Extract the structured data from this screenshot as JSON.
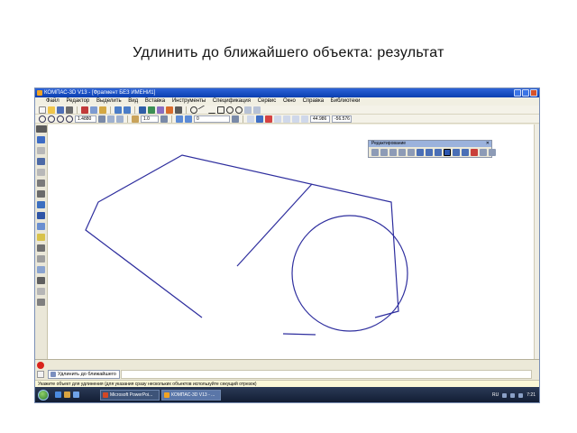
{
  "slide": {
    "title": "Удлинить до  ближайшего объекта: результат"
  },
  "app": {
    "window_title": "КОМПАС-3D V13 - [Фрагмент БЕЗ ИМЕНИ1]",
    "menu": [
      "Файл",
      "Редактор",
      "Выделить",
      "Вид",
      "Вставка",
      "Инструменты",
      "Спецификация",
      "Сервис",
      "Окно",
      "Справка",
      "Библиотеки"
    ],
    "toolbar": {
      "zoom_value": "1.4880",
      "line_scale": "1.0",
      "layer_value": "0",
      "coord_x": "44.986",
      "coord_y": "-56.576"
    },
    "edit_panel": {
      "title": "Редактирование",
      "close": "✕"
    },
    "command": {
      "tab_label": "Удлинить до ближайшего"
    },
    "status_text": "Укажите объект для удлинения (для указания сразу нескольких объектов используйте секущий отрезок)",
    "taskbar": {
      "tasks": [
        "Microsoft PowerPoi...",
        "КОМПАС-3D V13 - ..."
      ],
      "lang": "RU",
      "time": "7:21"
    },
    "colors": {
      "geometry": "#2e2e9e",
      "titlebar": "#0a3fb0",
      "statusbar": "#fbf8d8"
    }
  }
}
